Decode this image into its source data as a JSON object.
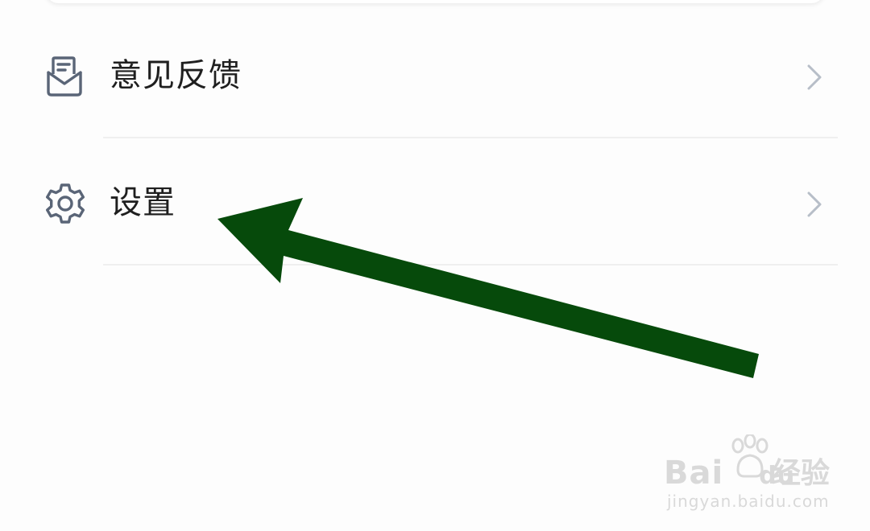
{
  "menu": {
    "items": [
      {
        "label": "意见反馈",
        "icon": "feedback-mail-icon"
      },
      {
        "label": "设置",
        "icon": "gear-icon"
      }
    ]
  },
  "annotation": {
    "arrow_color": "#064a0b",
    "points_to": "设置"
  },
  "watermark": {
    "logo_text_a": "Bai",
    "logo_text_b": "du",
    "logo_cn": "经验",
    "url": "jingyan.baidu.com"
  },
  "colors": {
    "icon": "#5a6577",
    "chevron": "#b7bec8",
    "divider": "#efefef",
    "label": "#1f1f1f"
  }
}
